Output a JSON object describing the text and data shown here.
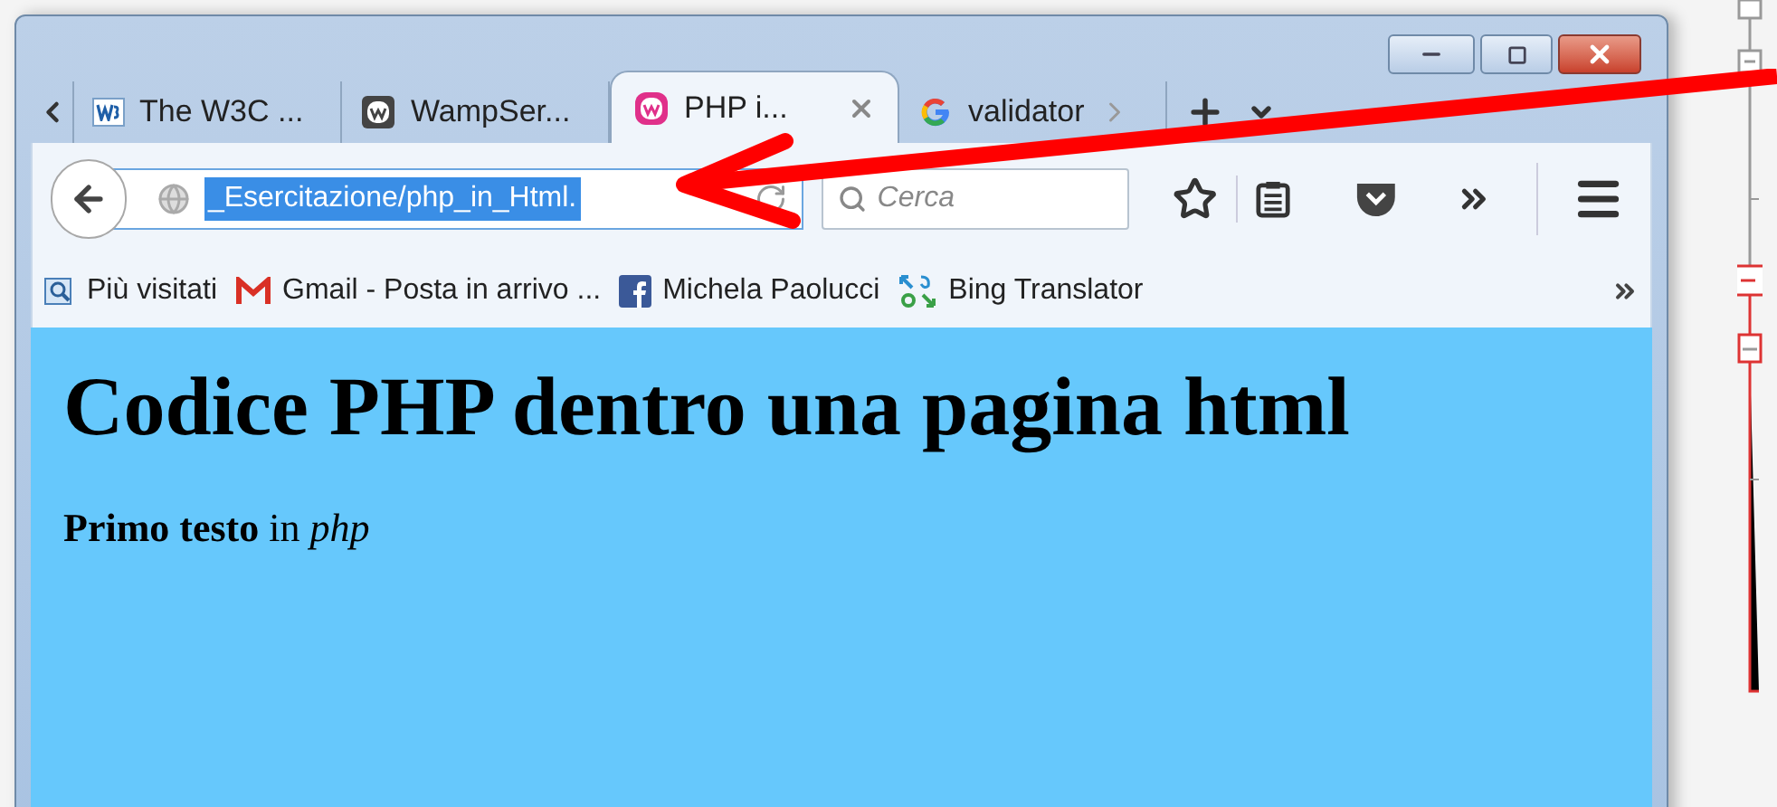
{
  "tabs": [
    {
      "label": "The W3C ...",
      "selected": false
    },
    {
      "label": "WampSer...",
      "selected": false
    },
    {
      "label": "PHP i...",
      "selected": true
    },
    {
      "label": "validator",
      "selected": false
    }
  ],
  "address_bar": {
    "value": "_Esercitazione/php_in_Html.",
    "text_selected": true
  },
  "search": {
    "placeholder": "Cerca"
  },
  "bookmarks": [
    "Più visitati",
    "Gmail - Posta in arrivo ...",
    "Michela Paolucci",
    "Bing Translator"
  ],
  "page": {
    "heading": "Codice PHP dentro una pagina html",
    "paragraph": "**Primo testo** in *php*"
  }
}
